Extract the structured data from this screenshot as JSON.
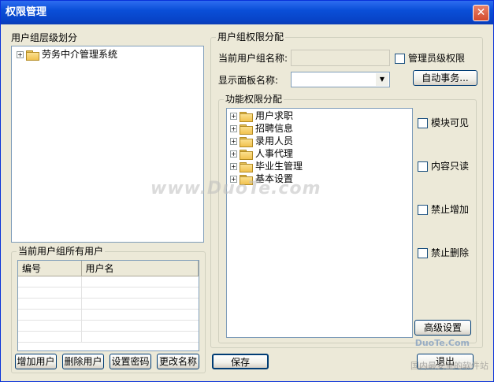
{
  "window": {
    "title": "权限管理",
    "close": "✕"
  },
  "left": {
    "hierarchy": {
      "label": "用户组层级划分",
      "root": {
        "label": "劳务中介管理系统"
      }
    },
    "users_group": {
      "label": "当前用户组所有用户",
      "columns": [
        "编号",
        "用户名"
      ],
      "rows": [
        [
          "",
          ""
        ],
        [
          "",
          ""
        ],
        [
          "",
          ""
        ],
        [
          "",
          ""
        ],
        [
          "",
          ""
        ],
        [
          "",
          ""
        ]
      ],
      "buttons": {
        "add": "增加用户",
        "delete": "删除用户",
        "password": "设置密码",
        "rename": "更改名称"
      }
    }
  },
  "right": {
    "group_perm": {
      "label": "用户组权限分配",
      "group_name_label": "当前用户组名称:",
      "group_name_value": "",
      "admin_checkbox": "管理员级权限",
      "panel_name_label": "显示面板名称:",
      "panel_name_value": "",
      "auto_task_button": "自动事务...",
      "func_perm": {
        "label": "功能权限分配",
        "items": [
          "用户求职",
          "招聘信息",
          "录用人员",
          "人事代理",
          "毕业生管理",
          "基本设置"
        ],
        "checkboxes": [
          "模块可见",
          "内容只读",
          "禁止增加",
          "禁止删除"
        ],
        "advanced_button": "高级设置"
      }
    },
    "save_button": "保存",
    "exit_button": "退出"
  },
  "watermarks": {
    "main": "www.DuoTe.com",
    "site": "DuoTe.Com",
    "caption": "国内最安全的软件站"
  }
}
